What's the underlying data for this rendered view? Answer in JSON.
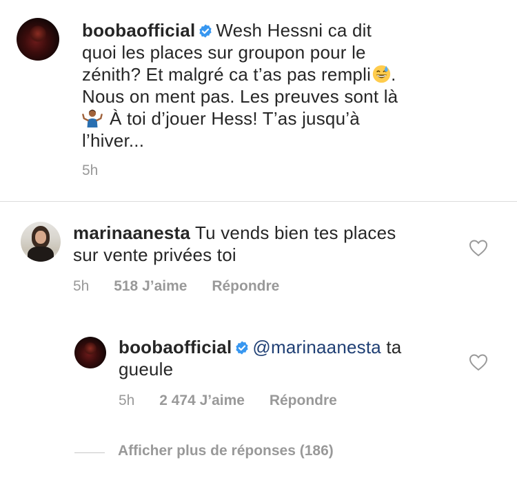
{
  "comments": [
    {
      "username": "boobaofficial",
      "verified": true,
      "text_line1": "Wesh Hessni ca dit",
      "text_line2": "quoi les places sur groupon pour le",
      "text_line3": "zénith? Et malgré ca t’as pas rempli",
      "text_line3_after_emoji": ".",
      "text_line4": "Nous on ment pas. Les preuves sont là",
      "text_line5": "À toi d’jouer Hess! T’as jusqu’à",
      "text_line6": "l’hiver...",
      "emoji_1": "grinning-face-with-sweat",
      "emoji_2": "person-shrugging",
      "time": "5h"
    },
    {
      "username": "marinaanesta",
      "verified": false,
      "text_line1": "Tu vends bien tes places",
      "text_line2": "sur vente privées toi",
      "time": "5h",
      "likes": "518 J’aime",
      "reply": "Répondre",
      "liked": false
    },
    {
      "username": "boobaofficial",
      "verified": true,
      "mention": "@marinaanesta",
      "text_line1_after_mention": "ta",
      "text_line2": "gueule",
      "time": "5h",
      "likes": "2 474 J’aime",
      "reply": "Répondre",
      "liked": false
    }
  ],
  "show_more_replies": "Afficher plus de réponses (186)",
  "colors": {
    "text": "#262626",
    "meta": "#999999",
    "mention": "#1f3f74",
    "verified": "#3897f0",
    "divider": "#dbdbdb"
  }
}
